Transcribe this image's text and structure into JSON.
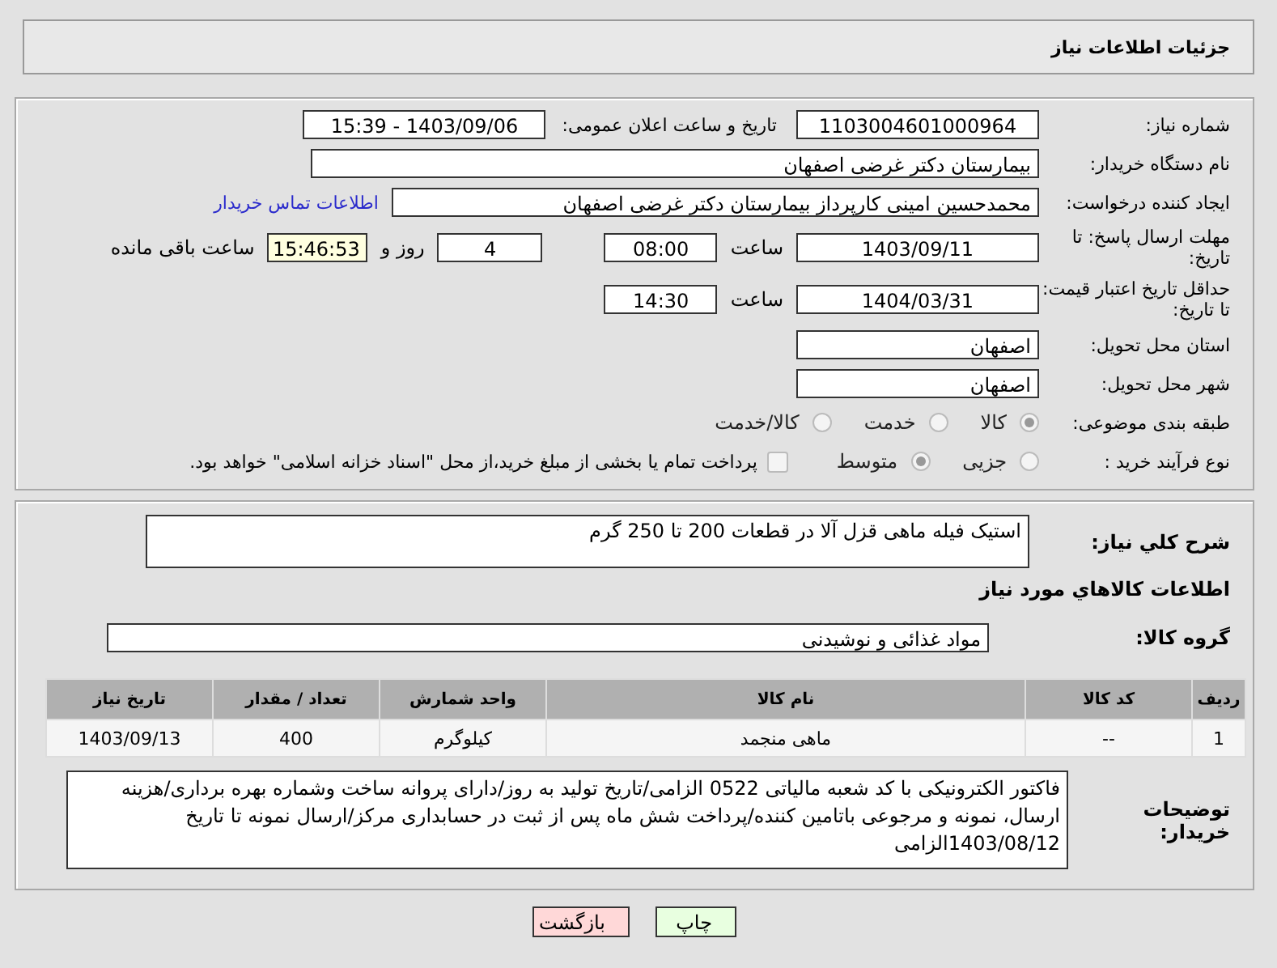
{
  "header": {
    "title": "جزئیات اطلاعات نیاز"
  },
  "need_number": {
    "label": "شماره نیاز:",
    "value": "1103004601000964"
  },
  "announce": {
    "label": "تاریخ و ساعت اعلان عمومی:",
    "value": "1403/09/06 - 15:39"
  },
  "buyer": {
    "label": "نام دستگاه خریدار:",
    "value": "بیمارستان دکتر غرضی اصفهان"
  },
  "requester": {
    "label": "ایجاد کننده درخواست:",
    "value": "محمدحسین امینی کارپرداز بیمارستان دکتر غرضی اصفهان",
    "link": "اطلاعات تماس خریدار"
  },
  "reply_deadline": {
    "label": "مهلت ارسال پاسخ: تا تاریخ:",
    "date": "1403/09/11",
    "time_label": "ساعت",
    "time": "08:00",
    "days": "4",
    "days_label": "روز و",
    "remaining": "15:46:53",
    "remaining_label": "ساعت باقی مانده"
  },
  "price_validity": {
    "label": "حداقل تاریخ اعتبار قیمت: تا تاریخ:",
    "date": "1404/03/31",
    "time_label": "ساعت",
    "time": "14:30"
  },
  "province": {
    "label": "استان محل تحویل:",
    "value": "اصفهان"
  },
  "city": {
    "label": "شهر محل تحویل:",
    "value": "اصفهان"
  },
  "category": {
    "label": "طبقه بندی موضوعی:",
    "options": [
      {
        "label": "کالا",
        "selected": true
      },
      {
        "label": "خدمت",
        "selected": false
      },
      {
        "label": "کالا/خدمت",
        "selected": false
      }
    ]
  },
  "process": {
    "label": "نوع فرآیند خرید :",
    "options": [
      {
        "label": "جزیی",
        "selected": false
      },
      {
        "label": "متوسط",
        "selected": true
      }
    ],
    "payment": {
      "checked": false,
      "text": "پرداخت تمام یا بخشی از مبلغ خرید،از محل \"اسناد خزانه اسلامی\" خواهد بود."
    }
  },
  "description": {
    "label": "شرح كلي نياز:",
    "value": "استیک فیله ماهی قزل آلا در قطعات 200 تا 250 گرم"
  },
  "goods_heading": "اطلاعات كالاهاي مورد نياز",
  "goods_group": {
    "label": "گروه کالا:",
    "value": "مواد غذائی و نوشیدنی"
  },
  "table": {
    "columns": [
      "ردیف",
      "کد کالا",
      "نام کالا",
      "واحد شمارش",
      "تعداد / مقدار",
      "تاریخ نیاز"
    ],
    "rows": [
      [
        "1",
        "--",
        "ماهی منجمد",
        "کیلوگرم",
        "400",
        "1403/09/13"
      ]
    ]
  },
  "buyer_notes": {
    "label": "توضیحات خریدار:",
    "value": "فاکتور الکترونیکی با کد شعبه مالیاتی 0522 الزامی/تاریخ تولید به روز/دارای پروانه ساخت وشماره بهره برداری/هزینه ارسال، نمونه و مرجوعی باتامین کننده/پرداخت شش ماه پس از ثبت در حسابداری مرکز/ارسال نمونه تا تاریخ 1403/08/12الزامی"
  },
  "buttons": [
    {
      "label": "چاپ",
      "kind": "print"
    },
    {
      "label": "بازگشت",
      "kind": "back"
    }
  ]
}
